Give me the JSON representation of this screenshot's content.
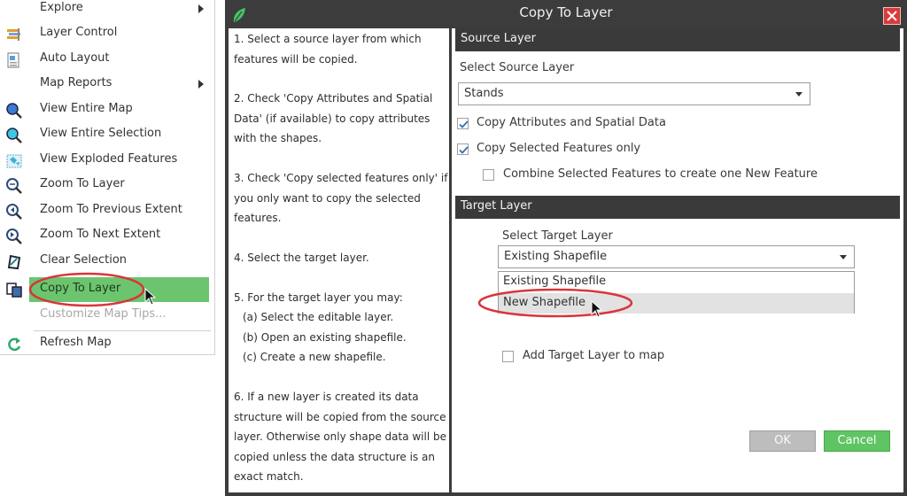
{
  "context_menu": {
    "items": [
      {
        "label": "Explore",
        "icon": "",
        "submenu": true
      },
      {
        "label": "Layer Control",
        "icon": "layers-icon"
      },
      {
        "label": "Auto Layout",
        "icon": "layout-icon"
      },
      {
        "label": "Map Reports",
        "icon": "",
        "submenu": true
      },
      {
        "label": "View Entire Map",
        "icon": "zoom-full-icon"
      },
      {
        "label": "View Entire Selection",
        "icon": "zoom-selection-icon"
      },
      {
        "label": "View Exploded Features",
        "icon": "exploded-features-icon"
      },
      {
        "label": "Zoom To Layer",
        "icon": "zoom-layer-icon"
      },
      {
        "label": "Zoom To Previous Extent",
        "icon": "zoom-previous-icon"
      },
      {
        "label": "Zoom To Next Extent",
        "icon": "zoom-next-icon"
      },
      {
        "label": "Clear Selection",
        "icon": "clear-selection-icon"
      },
      {
        "label": "Copy To Layer",
        "icon": "copy-layer-icon",
        "highlighted": true
      },
      {
        "label": "Customize Map Tips...",
        "icon": "",
        "disabled": true
      },
      {
        "label": "Refresh Map",
        "icon": "refresh-icon"
      }
    ]
  },
  "dialog": {
    "title": "Copy To Layer",
    "instructions": [
      "1. Select a source layer from which features will be copied.",
      "2. Check 'Copy Attributes and Spatial Data' (if available) to copy attributes with the shapes.",
      "3. Check 'Copy selected features only' if you only want to copy the selected features.",
      "4. Select the target layer.",
      "5. For the target layer you may:",
      "(a) Select the editable layer.",
      "(b) Open an existing shapefile.",
      "(c) Create a new shapefile.",
      "6. If a new layer is created its data structure will be copied from the source layer. Otherwise only shape data will be copied unless the data structure is an exact match."
    ],
    "source_section": {
      "header": "Source Layer",
      "select_label": "Select Source Layer",
      "select_value": "Stands",
      "copy_attributes": {
        "label": "Copy Attributes and Spatial Data",
        "checked": true
      },
      "copy_selected": {
        "label": "Copy Selected Features only",
        "checked": true
      },
      "combine_selected": {
        "label": "Combine Selected Features to create one New Feature",
        "checked": false
      }
    },
    "target_section": {
      "header": "Target Layer",
      "select_label": "Select Target Layer",
      "select_value": "Existing Shapefile",
      "options": [
        "Existing Shapefile",
        "New Shapefile"
      ],
      "hovered_option": "New Shapefile",
      "add_to_map": {
        "label": "Add Target Layer to map",
        "checked": false
      }
    },
    "buttons": {
      "ok": "OK",
      "cancel": "Cancel"
    }
  },
  "colors": {
    "accent_green": "#5fc463",
    "dialog_dark": "#3c3c3c",
    "annotation_red": "#d9343a",
    "close_red": "#d83b3b"
  }
}
